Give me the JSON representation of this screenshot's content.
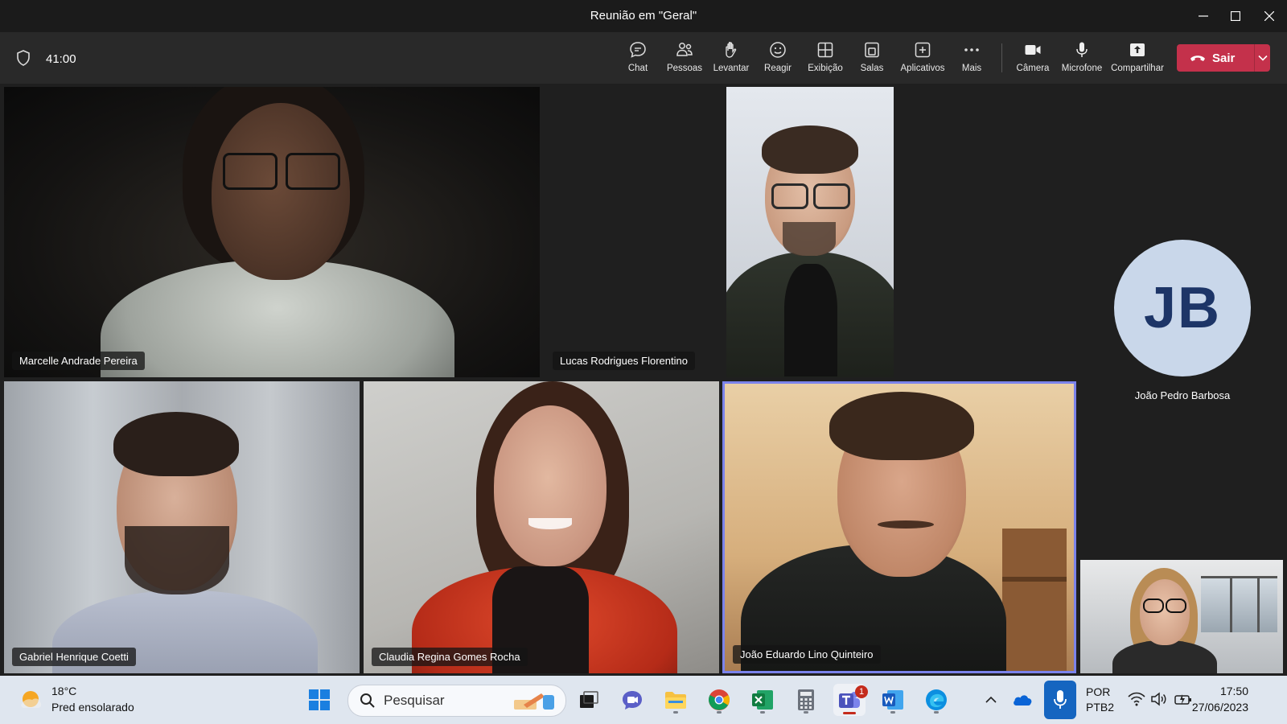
{
  "window": {
    "title": "Reunião em \"Geral\""
  },
  "toolbar": {
    "timer": "41:00",
    "buttons": [
      {
        "label": "Chat",
        "icon": "chat-icon"
      },
      {
        "label": "Pessoas",
        "icon": "people-icon"
      },
      {
        "label": "Levantar",
        "icon": "raise-hand-icon"
      },
      {
        "label": "Reagir",
        "icon": "smiley-icon"
      },
      {
        "label": "Exibição",
        "icon": "grid-view-icon"
      },
      {
        "label": "Salas",
        "icon": "breakout-rooms-icon"
      },
      {
        "label": "Aplicativos",
        "icon": "add-apps-icon"
      },
      {
        "label": "Mais",
        "icon": "more-icon"
      },
      {
        "label": "Câmera",
        "icon": "camera-icon"
      },
      {
        "label": "Microfone",
        "icon": "microphone-icon"
      },
      {
        "label": "Compartilhar",
        "icon": "share-icon"
      }
    ],
    "leave_label": "Sair",
    "leave_color": "#c4314b"
  },
  "participants": [
    {
      "name": "Marcelle Andrade Pereira"
    },
    {
      "name": "Lucas Rodrigues Florentino"
    },
    {
      "name": "Gabriel Henrique Coetti"
    },
    {
      "name": "Claudia Regina Gomes Rocha"
    },
    {
      "name": "João Eduardo Lino Quinteiro",
      "speaking": true
    },
    {
      "name": "João Pedro Barbosa",
      "initials": "JB"
    }
  ],
  "taskbar": {
    "weather_temp": "18°C",
    "weather_desc": "Pred ensolarado",
    "search_placeholder": "Pesquisar",
    "teams_badge": "1",
    "lang_top": "POR",
    "lang_bottom": "PTB2",
    "time": "17:50",
    "date": "27/06/2023"
  }
}
